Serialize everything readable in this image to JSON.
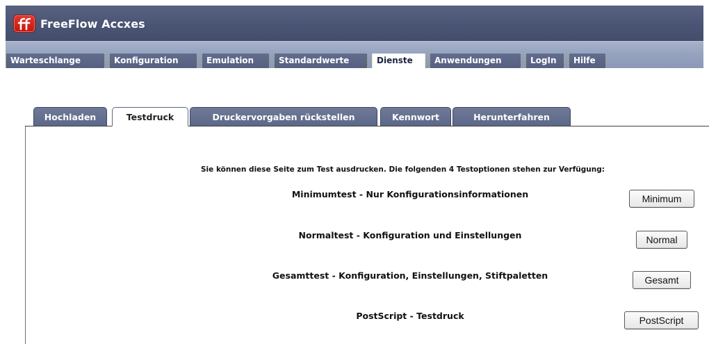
{
  "app": {
    "title": "FreeFlow Accxes",
    "logo_icon": "freeflow-logo-icon",
    "colors": {
      "header": "#4a5474",
      "navbar": "#96a3bf",
      "tab": "#5d6888",
      "active_tab": "#ffffff"
    }
  },
  "nav": {
    "items": [
      {
        "label": "Warteschlange"
      },
      {
        "label": "Konfiguration"
      },
      {
        "label": "Emulation"
      },
      {
        "label": "Standardwerte"
      },
      {
        "label": "Dienste",
        "active": true
      },
      {
        "label": "Anwendungen"
      },
      {
        "label": "LogIn"
      },
      {
        "label": "Hilfe"
      }
    ]
  },
  "subtabs": {
    "items": [
      {
        "label": "Hochladen"
      },
      {
        "label": "Testdruck",
        "active": true
      },
      {
        "label": "Druckervorgaben rückstellen"
      },
      {
        "label": "Kennwort"
      },
      {
        "label": "Herunterfahren"
      }
    ]
  },
  "content": {
    "intro": "Sie können diese Seite zum Test ausdrucken. Die folgenden 4 Testoptionen stehen zur Verfügung:",
    "tests": [
      {
        "label": "Minimumtest - Nur Konfigurationsinformationen",
        "button": "Minimum"
      },
      {
        "label": "Normaltest - Konfiguration und Einstellungen",
        "button": "Normal"
      },
      {
        "label": "Gesamttest - Konfiguration, Einstellungen, Stiftpaletten",
        "button": "Gesamt"
      },
      {
        "label": "PostScript -  Testdruck",
        "button": "PostScript"
      }
    ]
  }
}
